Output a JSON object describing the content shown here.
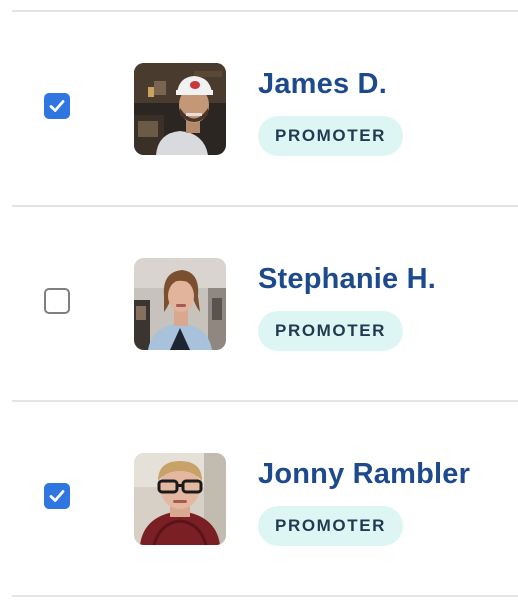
{
  "rows": [
    {
      "name": "James D.",
      "badge": "PROMOTER",
      "checked": true
    },
    {
      "name": "Stephanie H.",
      "badge": "PROMOTER",
      "checked": false
    },
    {
      "name": "Jonny Rambler",
      "badge": "PROMOTER",
      "checked": true
    }
  ],
  "colors": {
    "checkbox_checked": "#2f76e0",
    "checkbox_border": "#7f7f7f",
    "name_text": "#1d4a8c",
    "badge_background": "#def6f3",
    "badge_text": "#1f3a52",
    "divider": "#e4e4e4"
  },
  "icons": {
    "check": "checkmark-icon"
  }
}
